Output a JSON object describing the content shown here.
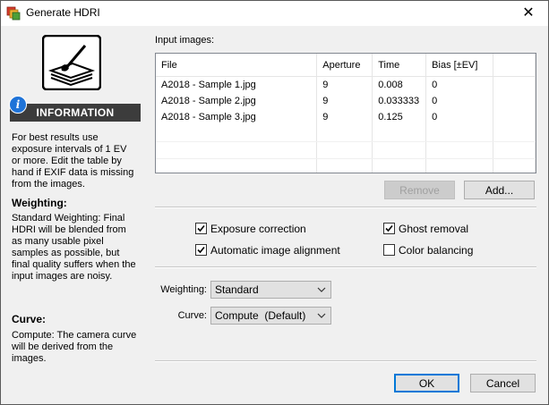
{
  "window": {
    "title": "Generate HDRI",
    "close_glyph": "✕"
  },
  "info_panel": {
    "header": "INFORMATION",
    "intro": "For best results use exposure intervals of 1 EV or more. Edit the table by hand if EXIF data is missing from the images.",
    "weighting_heading": "Weighting:",
    "weighting_text": "Standard Weighting: Final HDRI will be blended from as many usable pixel samples as possible, but final quality suffers when the input images are noisy.",
    "curve_heading": "Curve:",
    "curve_text": "Compute: The camera curve will be derived from the images."
  },
  "input_images": {
    "label": "Input images:",
    "columns": [
      "File",
      "Aperture",
      "Time",
      "Bias [±EV]"
    ],
    "rows": [
      [
        "A2018 - Sample 1.jpg",
        "9",
        "0.008",
        "0"
      ],
      [
        "A2018 - Sample 2.jpg",
        "9",
        "0.033333",
        "0"
      ],
      [
        "A2018 - Sample 3.jpg",
        "9",
        "0.125",
        "0"
      ]
    ],
    "remove_label": "Remove",
    "add_label": "Add..."
  },
  "options": {
    "exposure_correction": {
      "label": "Exposure correction",
      "checked": true
    },
    "ghost_removal": {
      "label": "Ghost removal",
      "checked": true
    },
    "auto_alignment": {
      "label": "Automatic image alignment",
      "checked": true
    },
    "color_balancing": {
      "label": "Color balancing",
      "checked": false
    }
  },
  "weighting": {
    "label": "Weighting:",
    "value": "Standard"
  },
  "curve": {
    "label": "Curve:",
    "value": "Compute  (Default)"
  },
  "footer": {
    "ok_label": "OK",
    "cancel_label": "Cancel"
  },
  "colors": {
    "accent": "#0078d7",
    "info_header_bg": "#3c3c3c",
    "info_icon": "#1e73d8"
  }
}
